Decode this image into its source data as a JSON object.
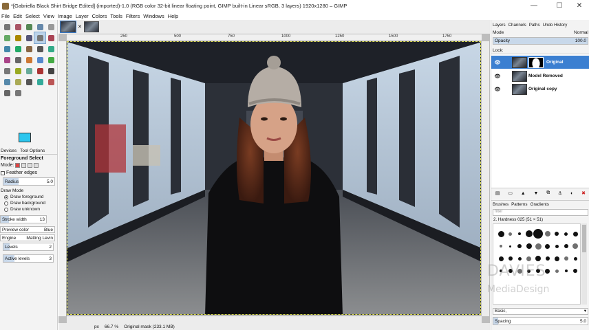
{
  "window": {
    "title": "*[Gabriella Black Shirt Bridge Edited] (imported)-1.0 (RGB color 32-bit linear floating point, GIMP built-in Linear sRGB, 3 layers) 1920x1280 – GIMP",
    "minimize": "—",
    "maximize": "☐",
    "close": "✕"
  },
  "menu": [
    "File",
    "Edit",
    "Select",
    "View",
    "Image",
    "Layer",
    "Colors",
    "Tools",
    "Filters",
    "Windows",
    "Help"
  ],
  "image_tabs": {
    "close": "✕"
  },
  "ruler": {
    "ticks": [
      "250",
      "500",
      "750",
      "1000",
      "1250",
      "1500",
      "1750"
    ]
  },
  "toolbox": {
    "colors": {
      "foreground": "#2cc6ee",
      "background": "#f2e300"
    },
    "tabs": [
      "Devices",
      "Tool Options"
    ],
    "tool_title": "Foreground Select",
    "mode_label": "Mode:",
    "feather_label": "Feather edges",
    "radius_label": "Radius",
    "radius_value": "5.0",
    "draw_mode_label": "Draw Mode",
    "draw_options": [
      "Draw foreground",
      "Draw background",
      "Draw unknown"
    ],
    "selected_draw_option": 0,
    "stroke_label": "Stroke width",
    "stroke_value": "13",
    "preview_color_label": "Preview color",
    "preview_color_value": "Blue",
    "engine_label": "Engine",
    "engine_value": "Matting Levin",
    "levels_label": "Levels",
    "levels_value": "2",
    "active_levels_label": "Active levels",
    "active_levels_value": "3"
  },
  "status": {
    "unit": "px",
    "zoom": "66.7 %",
    "message": "Original mask (233.1 MB)"
  },
  "layers_dock": {
    "tabs": [
      "Layers",
      "Channels",
      "Paths",
      "Undo History"
    ],
    "mode_label": "Mode",
    "mode_value": "Normal",
    "opacity_label": "Opacity",
    "opacity_value": "100.0",
    "opacity_fraction": 1.0,
    "lock_label": "Lock:",
    "layers": [
      {
        "name": "Original",
        "selected": true,
        "has_mask": true
      },
      {
        "name": "Model Removed",
        "selected": false,
        "has_mask": false
      },
      {
        "name": "Original copy",
        "selected": false,
        "has_mask": false
      }
    ]
  },
  "brushes_dock": {
    "tabs": [
      "Brushes",
      "Patterns",
      "Gradients"
    ],
    "filter_placeholder": "filter",
    "current_brush": "2. Hardness 025 (51 × 51)",
    "preset": "Basic,",
    "spacing_label": "Spacing",
    "spacing_value": "5.0"
  },
  "watermark": {
    "line1": "DAVIES",
    "line2": "MediaDesign"
  }
}
